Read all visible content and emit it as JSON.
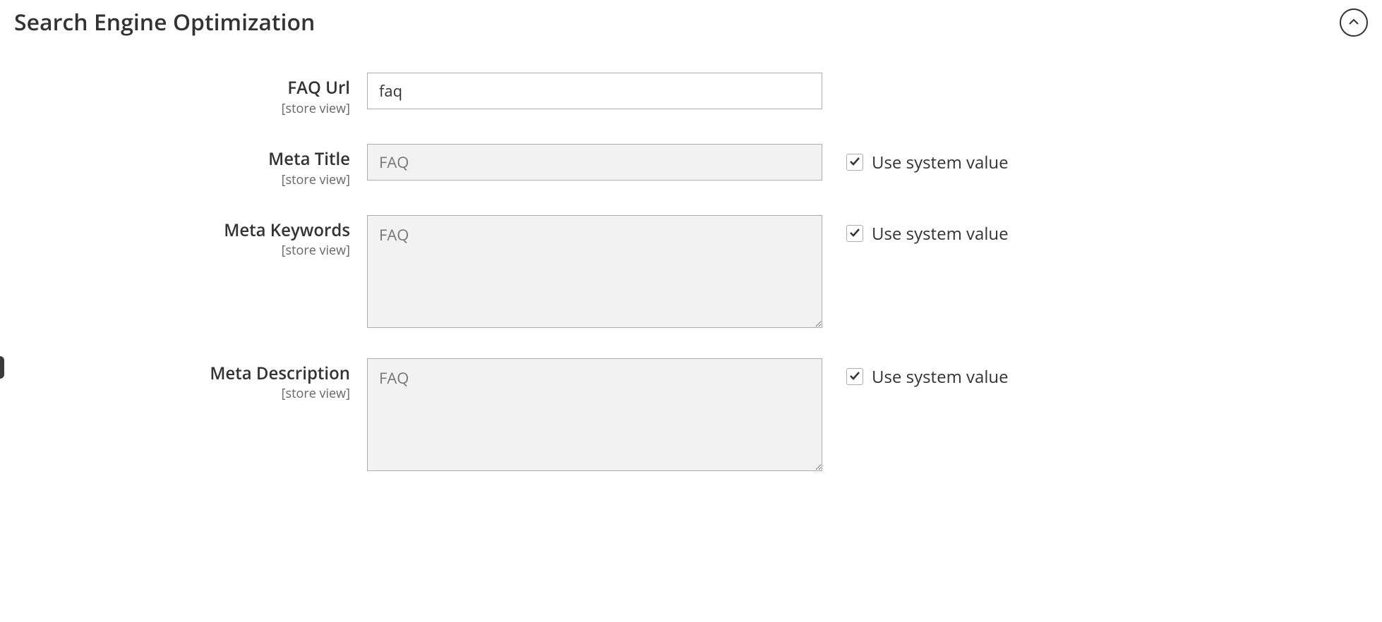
{
  "section": {
    "title": "Search Engine Optimization"
  },
  "fields": {
    "faq_url": {
      "label": "FAQ Url",
      "scope": "[store view]",
      "value": "faq"
    },
    "meta_title": {
      "label": "Meta Title",
      "scope": "[store view]",
      "value": "FAQ",
      "use_system": true,
      "system_label": "Use system value"
    },
    "meta_keywords": {
      "label": "Meta Keywords",
      "scope": "[store view]",
      "value": "FAQ",
      "use_system": true,
      "system_label": "Use system value"
    },
    "meta_description": {
      "label": "Meta Description",
      "scope": "[store view]",
      "value": "FAQ",
      "use_system": true,
      "system_label": "Use system value"
    }
  }
}
